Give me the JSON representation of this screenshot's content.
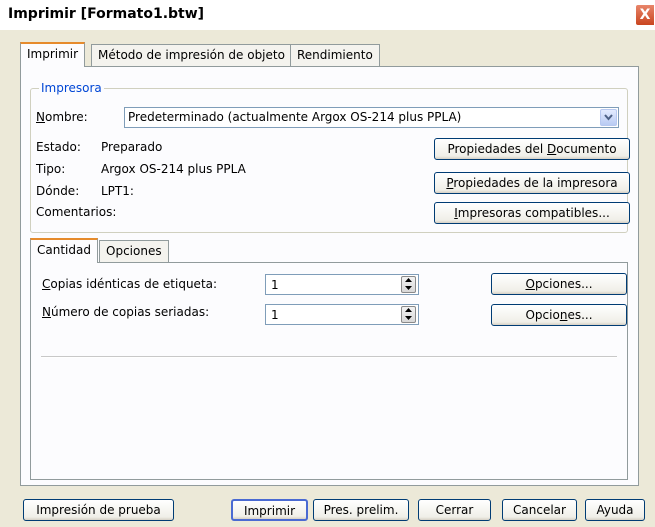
{
  "window": {
    "title": "Imprimir [Formato1.btw]",
    "close_glyph": "X"
  },
  "main_tabs": [
    {
      "label": "Imprimir",
      "active": true
    },
    {
      "label": "Método de impresión de objeto",
      "active": false
    },
    {
      "label": "Rendimiento",
      "active": false
    }
  ],
  "printer": {
    "group_label": "Impresora",
    "name_label_u": "N",
    "name_label_rest": "ombre:",
    "name_value": "Predeterminado (actualmente Argox OS-214 plus PPLA)",
    "status_label": "Estado:",
    "status_value": "Preparado",
    "type_label": "Tipo:",
    "type_value": "Argox OS-214 plus PPLA",
    "where_label": "Dónde:",
    "where_value": "LPT1:",
    "comments_label": "Comentarios:",
    "doc_props_pre": "Propiedades del ",
    "doc_props_u": "D",
    "doc_props_post": "ocumento",
    "printer_props_u": "P",
    "printer_props_post": "ropiedades de la impresora",
    "compatible_u": "I",
    "compatible_post": "mpresoras compatibles..."
  },
  "sub_tabs": [
    {
      "label": "Cantidad",
      "active": true
    },
    {
      "label": "Opciones",
      "active": false
    }
  ],
  "quantity": {
    "identical_u": "C",
    "identical_rest": "opias idénticas de etiqueta:",
    "identical_value": "1",
    "serial_u": "N",
    "serial_rest": "úmero de copias seriadas:",
    "serial_value": "1",
    "options1_u": "O",
    "options1_rest": "pciones...",
    "options2_pre": "Opcio",
    "options2_u": "n",
    "options2_post": "es..."
  },
  "buttons": {
    "test_print": "Impresión de prueba",
    "print": "Imprimir",
    "preview": "Pres. prelim.",
    "close": "Cerrar",
    "cancel": "Cancelar",
    "help": "Ayuda"
  }
}
